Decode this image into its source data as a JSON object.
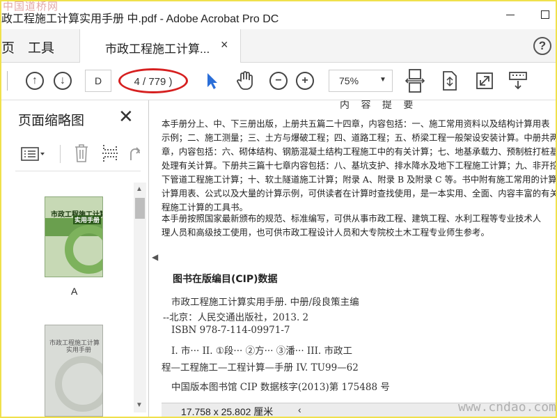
{
  "window": {
    "title": "政工程施工计算实用手册  中.pdf - Adobe Acrobat Pro DC",
    "watermark": "中国道桥网"
  },
  "tabs": {
    "home": "页",
    "tools": "工具",
    "document": "市政工程施工计算...",
    "close": "×",
    "help": "?"
  },
  "toolbar": {
    "page_field": "D",
    "page_count": "4 / 779 )",
    "zoom": "75%"
  },
  "panel": {
    "title": "页面缩略图",
    "thumb1_title": "市政工程施工计算",
    "thumb1_subtitle": "实用手册",
    "thumb1_label": "A",
    "thumb2_title": "市政工程施工计算",
    "thumb2_subtitle": "实用手册"
  },
  "document": {
    "heading": "内 容 提 要",
    "lines": [
      "    本手册分上、中、下三册出版，上册共五篇二十四章，内容包括：一、施工常用资料以及结构计算用表",
      "示例；二、施工测量；三、土方与爆破工程；四、道路工程；五、桥梁工程一般架设安装计算。中册共两篇",
      "章，内容包括：六、砌体结构、钢筋混凝土结构工程施工中的有关计算；七、地基承载力、预制桩打桩基础及",
      "处理有关计算。下册共三篇十七章内容包括：八、基坑支护、排水降水及地下工程施工计算；九、非开挖铺",
      "下管道工程施工计算；十、软土隧道施工计算；附录 A、附录 B 及附录 C 等。书中附有施工常用的计算资",
      "计算用表、公式以及大量的计算示例，可供读者在计算时查找使用，是一本实用、全面、内容丰富的有关市",
      "程施工计算的工具书。",
      "    本手册按照国家最新颁布的规范、标准编写，可供从事市政工程、建筑工程、水利工程等专业技术人",
      "理人员和高级技工使用，也可供市政工程设计人员和大专院校土木工程专业师生参考。"
    ],
    "cip_title": "图书在版编目(CIP)数据",
    "cip": [
      "市政工程施工计算实用手册. 中册/段良策主编",
      "--北京：人民交通出版社，2013. 2",
      "ISBN  978-7-114-09971-7",
      "I. 市···   II. ①段···   ②方···   ③潘···   III. 市政工",
      "程—工程施工—工程计算—手册   IV. TU99—62",
      "中国版本图书馆 CIP 数据核字(2013)第 175488 号"
    ]
  },
  "status": {
    "dimensions": "17.758 x 25.802 厘米",
    "site_watermark": "www.cndao.com"
  }
}
